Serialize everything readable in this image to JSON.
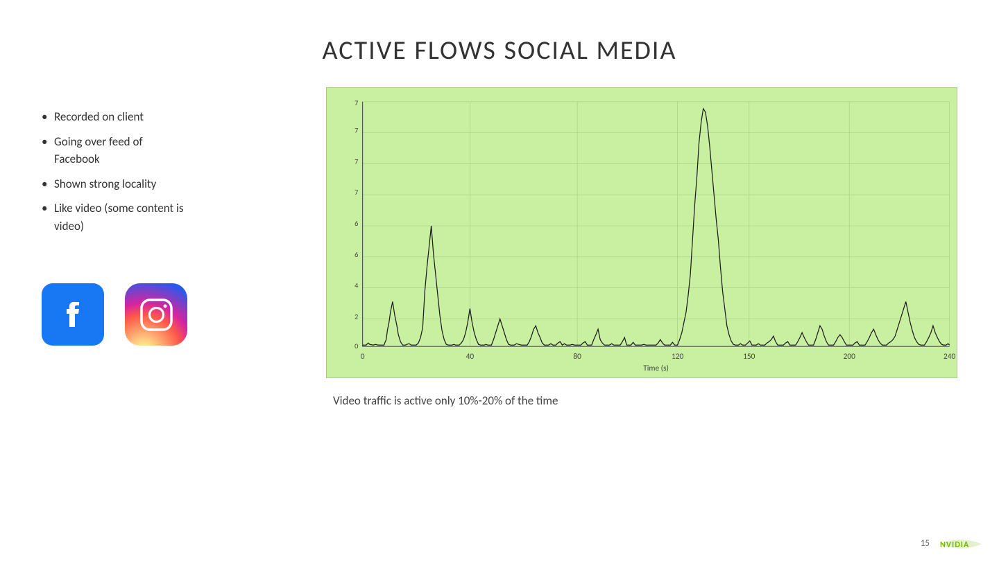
{
  "title": "ACTIVE FLOWS SOCIAL MEDIA",
  "left": {
    "bullets": [
      "Recorded on client",
      "Going over feed of Facebook",
      "Shown strong locality",
      "Like video (some content is video)"
    ]
  },
  "chart": {
    "caption": "Video traffic is active only 10%-20% of the time",
    "x_label": "Time (s)",
    "x_ticks": [
      "0",
      "40",
      "80",
      "120",
      "150",
      "200",
      "240"
    ]
  },
  "page": {
    "number": "15"
  }
}
